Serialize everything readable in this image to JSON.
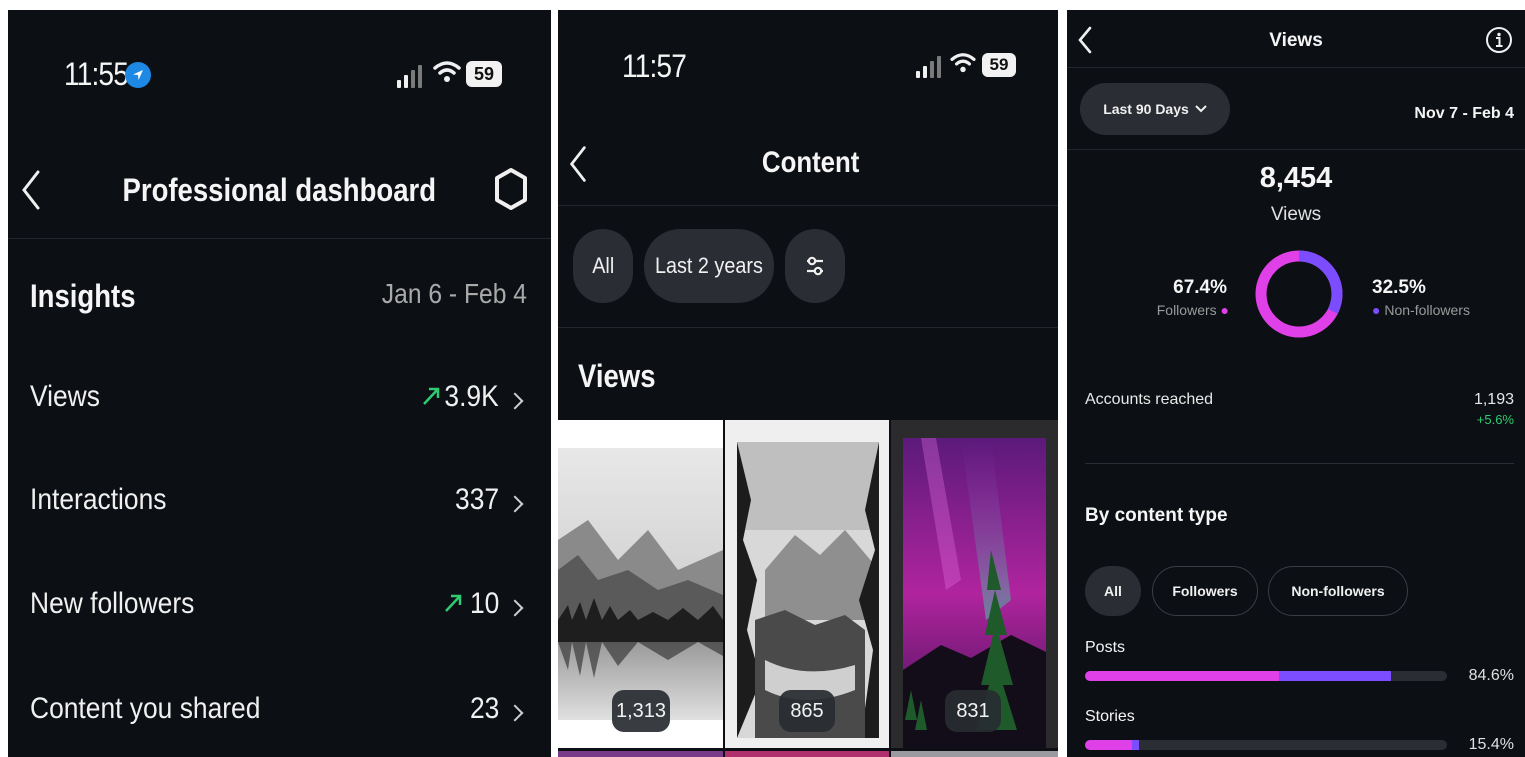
{
  "dashboard": {
    "status": {
      "time": "11:55",
      "battery": "59"
    },
    "title": "Professional dashboard",
    "insights": {
      "heading": "Insights",
      "date_range": "Jan 6 - Feb 4"
    },
    "rows": [
      {
        "label": "Views",
        "value": "3.9K",
        "trend": "up"
      },
      {
        "label": "Interactions",
        "value": "337",
        "trend": "none"
      },
      {
        "label": "New followers",
        "value": "10",
        "trend": "up"
      },
      {
        "label": "Content you shared",
        "value": "23",
        "trend": "none"
      }
    ]
  },
  "content": {
    "status": {
      "time": "11:57",
      "battery": "59"
    },
    "title": "Content",
    "filters": {
      "all": "All",
      "range": "Last 2 years"
    },
    "section": "Views",
    "items": [
      {
        "count": "1,313",
        "image": "bw-mountain-lake"
      },
      {
        "count": "865",
        "image": "bw-forest-river"
      },
      {
        "count": "831",
        "image": "aurora-tree"
      }
    ]
  },
  "views": {
    "title": "Views",
    "range_button": "Last 90 Days",
    "date_range": "Nov 7 - Feb 4",
    "total": "8,454",
    "total_label": "Views",
    "followers_pct": "67.4%",
    "followers_label": "Followers",
    "nonfollowers_pct": "32.5%",
    "nonfollowers_label": "Non-followers",
    "accounts_reached_label": "Accounts reached",
    "accounts_reached_value": "1,193",
    "accounts_reached_change": "+5.6%",
    "by_content_type": "By content type",
    "tabs": [
      "All",
      "Followers",
      "Non-followers"
    ],
    "types": [
      {
        "label": "Posts",
        "pct": "84.6%",
        "followers_share": 0.537,
        "nonfollowers_share": 0.309
      },
      {
        "label": "Stories",
        "pct": "15.4%",
        "followers_share": 0.13,
        "nonfollowers_share": 0.02
      }
    ],
    "colors": {
      "followers": "#e040e8",
      "nonfollowers": "#7c4dff",
      "positive": "#2ecc71"
    }
  }
}
